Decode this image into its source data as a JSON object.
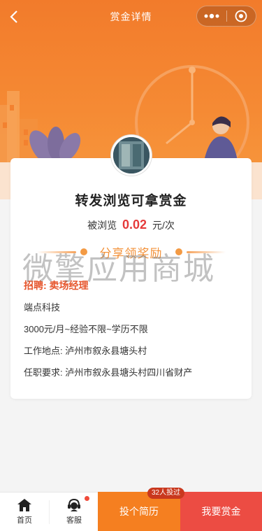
{
  "header": {
    "title": "赏金详情",
    "back_icon": "chevron-left-icon",
    "more_icon": "more-dots-icon",
    "close_icon": "target-close-icon"
  },
  "card": {
    "title": "转发浏览可拿赏金",
    "views_prefix": "被浏览",
    "views_amount": "0.02",
    "views_suffix": "元/次",
    "share_text": "分享领奖励",
    "job": "招聘: 卖场经理",
    "company": "端点科技",
    "salary": "3000元/月~经验不限~学历不限",
    "location": "工作地点: 泸州市叙永县塘头村",
    "requirement": "任职要求: 泸州市叙永县塘头村四川省财产"
  },
  "watermark": "微擎应用商城",
  "bottom": {
    "home_label": "首页",
    "service_label": "客服",
    "resume_label": "投个简历",
    "cast_badge": "32人投过",
    "reward_label": "我要赏金"
  },
  "colors": {
    "accent_orange": "#f57f20",
    "reward_red": "#ec4c43",
    "amount_red": "#e53a3a"
  }
}
